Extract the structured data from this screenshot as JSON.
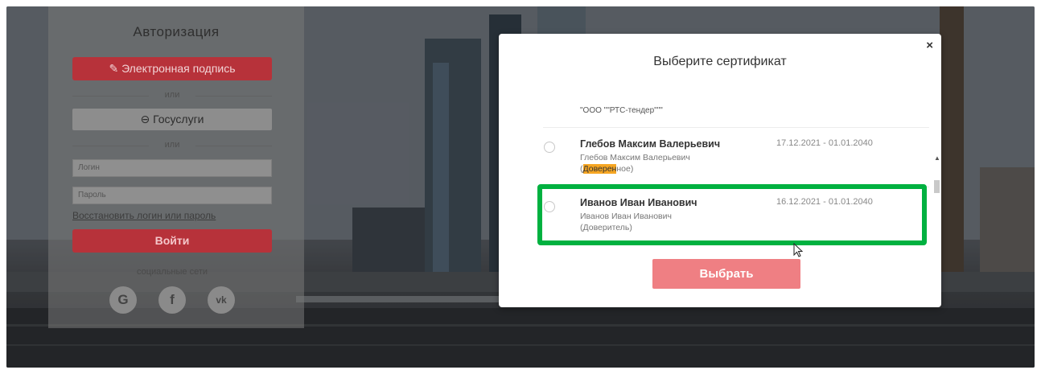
{
  "login": {
    "title": "Авторизация",
    "esign_label": "Электронная подпись",
    "or_label": "или",
    "gosuslugi_label": "Госуслуги",
    "login_placeholder": "Логин",
    "password_placeholder": "Пароль",
    "restore_link": "Восстановить логин или пароль",
    "submit_label": "Войти",
    "social_label": "социальные сети",
    "social": [
      {
        "name": "google",
        "glyph": "G"
      },
      {
        "name": "facebook",
        "glyph": "f"
      },
      {
        "name": "vk",
        "glyph": "vk"
      }
    ]
  },
  "modal": {
    "title": "Выберите сертификат",
    "close_glyph": "×",
    "prev_org": "\"ООО \"\"РТС-тендер\"\"\"",
    "certs": [
      {
        "name": "Глебов Максим Валерьевич",
        "dates": "17.12.2021 - 01.01.2040",
        "sub": "Глебов Максим Валерьевич",
        "role_prefix": "(",
        "role_highlight": "Доверен",
        "role_suffix": "ное)"
      },
      {
        "name": "Иванов Иван Иванович",
        "dates": "16.12.2021 - 01.01.2040",
        "sub": "Иванов Иван Иванович",
        "role": "(Доверитель)"
      }
    ],
    "select_label": "Выбрать"
  },
  "colors": {
    "brand_red": "#b7323a",
    "select_button": "#ef7f83",
    "highlight_box": "#00b140",
    "text_highlight": "#f6a623"
  },
  "icons": {
    "esign": "pen-icon",
    "gosuslugi": "gosuslugi-logo-icon",
    "close": "close-icon",
    "cursor": "mouse-cursor-icon"
  }
}
